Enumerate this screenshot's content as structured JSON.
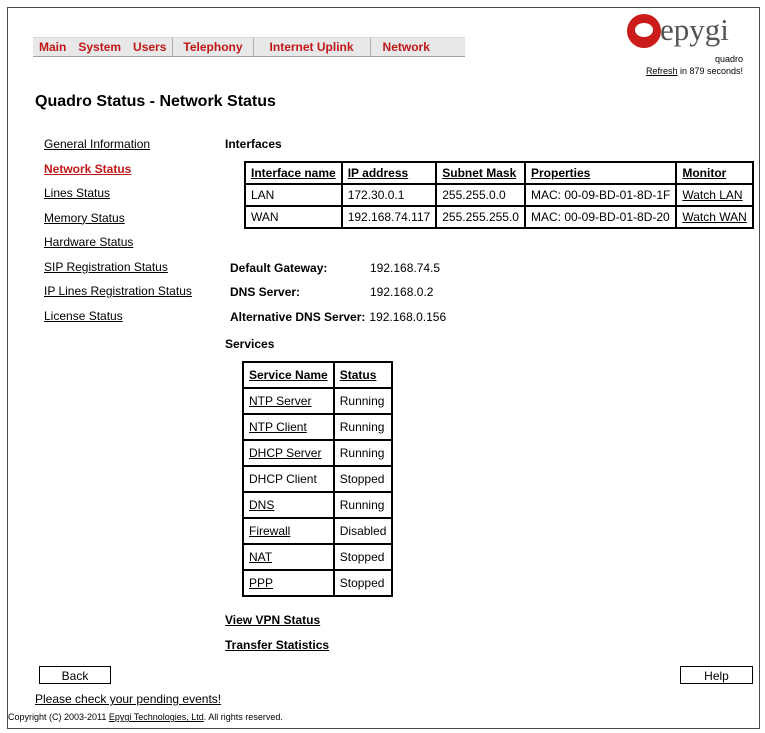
{
  "menu": {
    "items": [
      "Main",
      "System",
      "Users",
      "Telephony",
      "Internet Uplink",
      "Network"
    ]
  },
  "logo": {
    "brand": "epygi",
    "product": "quadro"
  },
  "refresh": {
    "link": "Refresh",
    "suffix": " in 879 seconds!"
  },
  "page": {
    "title": "Quadro Status - Network Status"
  },
  "sidebar": {
    "items": [
      {
        "label": "General Information"
      },
      {
        "label": "Network Status"
      },
      {
        "label": "Lines Status"
      },
      {
        "label": "Memory Status"
      },
      {
        "label": "Hardware Status"
      },
      {
        "label": "SIP Registration Status"
      },
      {
        "label": "IP Lines Registration Status"
      },
      {
        "label": "License Status"
      }
    ]
  },
  "interfaces": {
    "heading": "Interfaces",
    "headers": [
      "Interface name",
      "IP address",
      "Subnet Mask",
      "Properties",
      "Monitor"
    ],
    "rows": [
      {
        "name": "LAN",
        "ip": "172.30.0.1",
        "mask": "255.255.0.0",
        "props": "MAC: 00-09-BD-01-8D-1F",
        "monitor": "Watch LAN"
      },
      {
        "name": "WAN",
        "ip": "192.168.74.117",
        "mask": "255.255.255.0",
        "props": "MAC: 00-09-BD-01-8D-20",
        "monitor": "Watch WAN"
      }
    ]
  },
  "network": {
    "gateway_label": "Default Gateway:",
    "gateway": "192.168.74.5",
    "dns_label": "DNS Server:",
    "dns": "192.168.0.2",
    "alt_dns_label": "Alternative DNS Server:",
    "alt_dns": "192.168.0.156"
  },
  "services": {
    "heading": "Services",
    "headers": [
      "Service Name",
      "Status"
    ],
    "rows": [
      {
        "name": "NTP Server",
        "status": "Running"
      },
      {
        "name": "NTP Client",
        "status": "Running"
      },
      {
        "name": "DHCP Server",
        "status": "Running"
      },
      {
        "name": "DHCP Client",
        "status": "Stopped"
      },
      {
        "name": "DNS",
        "status": "Running"
      },
      {
        "name": "Firewall",
        "status": "Disabled"
      },
      {
        "name": "NAT",
        "status": "Stopped"
      },
      {
        "name": "PPP",
        "status": "Stopped"
      }
    ]
  },
  "links": {
    "vpn": "View VPN Status",
    "transfer": "Transfer Statistics"
  },
  "buttons": {
    "back": "Back",
    "help": "Help"
  },
  "footer": {
    "pending": "Please check your pending events!",
    "copyright_prefix": "Copyright (C) 2003-2011 ",
    "company": "Epygi Technologies, Ltd",
    "copyright_suffix": ". All rights reserved."
  }
}
